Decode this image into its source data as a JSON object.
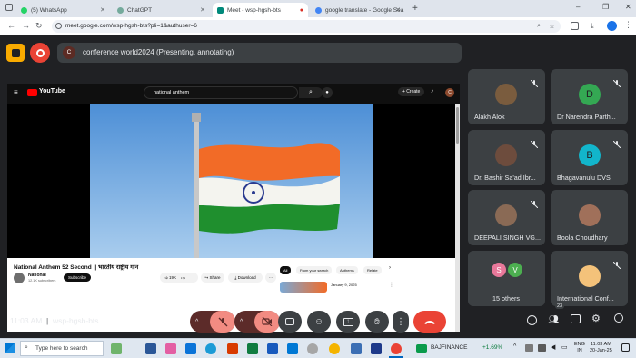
{
  "browser": {
    "tabs": [
      {
        "label": "(5) WhatsApp",
        "color": "#25d366"
      },
      {
        "label": "ChatGPT",
        "color": "#74aa9c"
      },
      {
        "label": "Meet - wsp-hgsh-bts",
        "color": "#00897b"
      },
      {
        "label": "google translate - Google Sea",
        "color": "#4285f4"
      }
    ],
    "new_tab": "+",
    "url": "meet.google.com/wsp-hgsh-bts?pli=1&authuser=6",
    "win_min": "–",
    "win_max": "❐",
    "win_close": "✕"
  },
  "meet": {
    "presenter_initial": "C",
    "presenting_label": "conference world2024 (Presenting, annotating)",
    "time": "11:03 AM",
    "meeting_code": "wsp-hgsh-bts",
    "participant_count": "23",
    "participants": [
      {
        "name": "Alakh Alok",
        "initial": "",
        "color": "#7a5c3e"
      },
      {
        "name": "Dr Narendra Parth...",
        "initial": "D",
        "color": "#34a853"
      },
      {
        "name": "Dr. Bashir Sa'ad Ibr...",
        "initial": "",
        "color": "#6d4c3d"
      },
      {
        "name": "Bhagavanulu DVS",
        "initial": "B",
        "color": "#12b5cb"
      },
      {
        "name": "DEEPALI SINGH VG...",
        "initial": "",
        "color": "#8a6a55"
      },
      {
        "name": "Boola Choudhary",
        "initial": "",
        "color": "#a0705a"
      },
      {
        "name": "15 others",
        "initial": "S",
        "initial2": "V",
        "color": "#e8789a",
        "color2": "#4caf50"
      },
      {
        "name": "International Conf...",
        "initial": "",
        "color": "#f4c27a"
      }
    ]
  },
  "youtube": {
    "logo": "YouTube",
    "search": "national anthem",
    "create": "+ Create",
    "avatar": "C",
    "title": "National Anthem 52 Second || भारतीय राष्ट्रीय गान",
    "channel": "National",
    "subscribers": "12.1K subscribers",
    "subscribe": "Subscribe",
    "likes": "19K",
    "share": "Share",
    "download": "Download",
    "more": "···",
    "chips": [
      "All",
      "From your search",
      "Anthems",
      "Relate"
    ],
    "rec_date": "January 9, 2025"
  },
  "taskbar": {
    "search": "Type here to search",
    "stock_name": "BAJFINANCE",
    "stock_change": "+1.69%",
    "lang1": "ENG",
    "lang2": "IN",
    "time": "11:03 AM",
    "date": "20-Jan-25"
  }
}
